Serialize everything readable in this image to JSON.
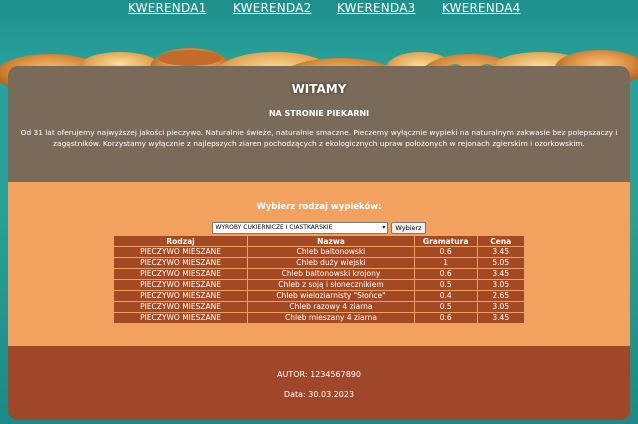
{
  "nav": {
    "links": [
      "KWERENDA1",
      "KWERENDA2",
      "KWERENDA3",
      "KWERENDA4"
    ]
  },
  "banner": {
    "title": "WITAMY",
    "subtitle": "NA STRONIE PIEKARNI",
    "description": "Od 31 lat oferujemy najwyższej jakości pieczywo. Naturalnie świeże, naturalnie smaczne. Pieczemy wyłącznie wypieki na naturalnym zakwasie bez polepszaczy i zagęstników. Korzystamy wyłącznie z najlepszych ziaren pochodzących z ekologicznych upraw położonych w rejonach zgierskim i ozorkowskim."
  },
  "filter": {
    "label": "Wybierz rodzaj wypieków:",
    "selected": "WYROBY CUKIERNICZE I CIASTKARSKIE",
    "button": "Wybierz"
  },
  "table": {
    "headers": [
      "Rodzaj",
      "Nazwa",
      "Gramatura",
      "Cena"
    ],
    "rows": [
      [
        "PIECZYWO MIESZANE",
        "Chleb baltonowski",
        "0.6",
        "3.45"
      ],
      [
        "PIECZYWO MIESZANE",
        "Chleb duży wiejski",
        "1",
        "5.05"
      ],
      [
        "PIECZYWO MIESZANE",
        "Chleb baltonowski krojony",
        "0.6",
        "3.45"
      ],
      [
        "PIECZYWO MIESZANE",
        "Chleb z soją i słonecznikiem",
        "0.5",
        "3.05"
      ],
      [
        "PIECZYWO MIESZANE",
        "Chleb wieloziarnisty \"Słońce\"",
        "0.4",
        "2.65"
      ],
      [
        "PIECZYWO MIESZANE",
        "Chleb razowy 4 ziarna",
        "0.5",
        "3.05"
      ],
      [
        "PIECZYWO MIESZANE",
        "Chleb mieszany 4 ziarna",
        "0.6",
        "3.45"
      ]
    ]
  },
  "footer": {
    "autor": "AUTOR: 1234567890",
    "data": "Data: 30.03.2023"
  }
}
